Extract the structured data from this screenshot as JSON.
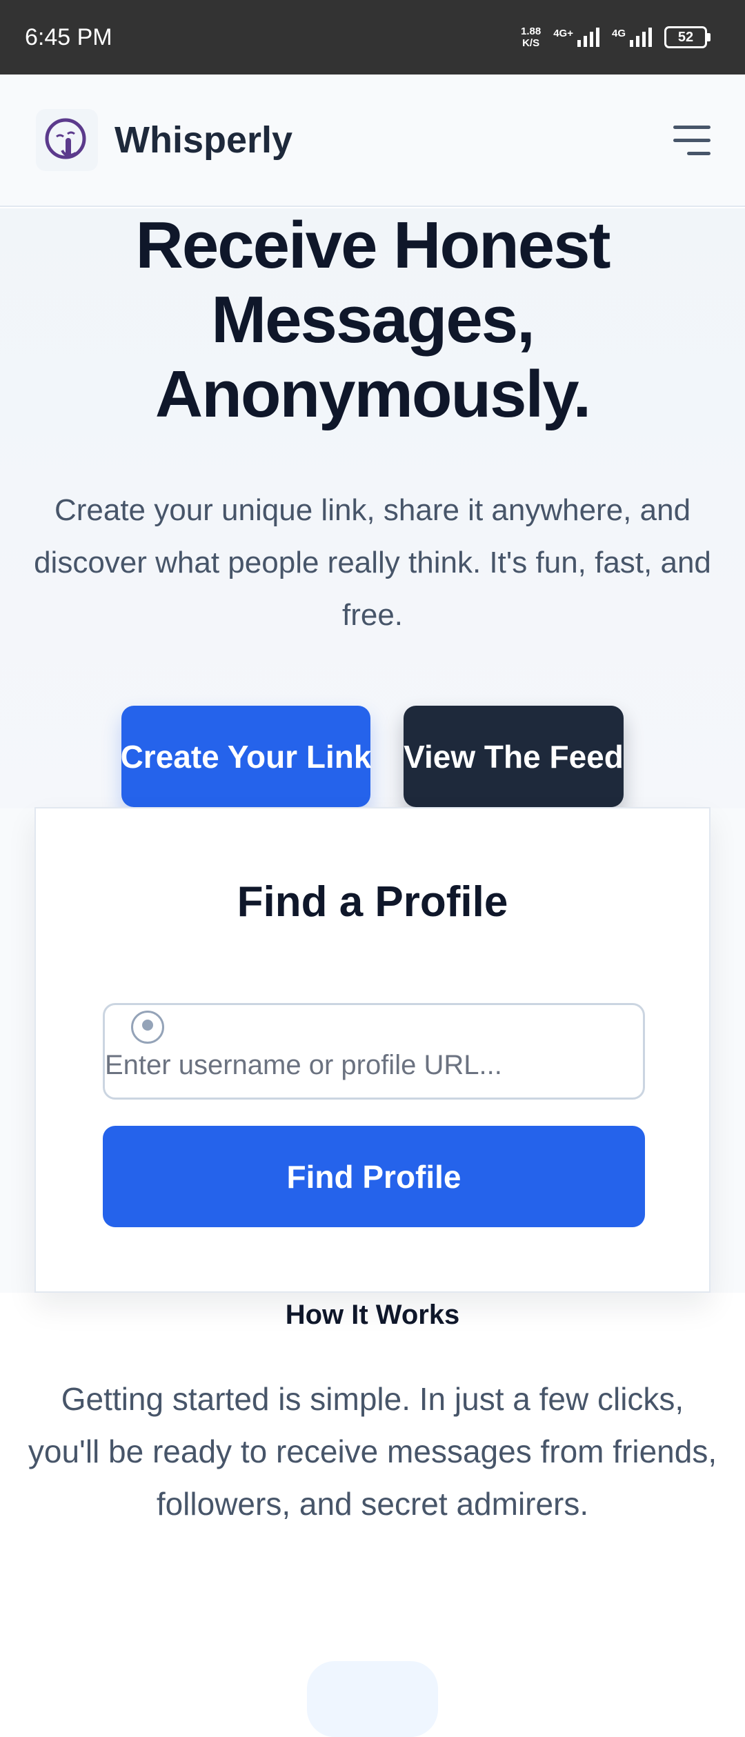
{
  "status_bar": {
    "time": "6:45 PM",
    "net_speed_value": "1.88",
    "net_speed_unit": "K/S",
    "signal_1_label": "4G+",
    "signal_2_label": "4G",
    "battery": "52"
  },
  "header": {
    "brand": "Whisperly",
    "logo_icon": "shush-face-icon",
    "menu_icon": "hamburger-menu-icon"
  },
  "hero": {
    "title_line1": "Receive Honest",
    "title_line2": "Messages,",
    "title_line3": "Anonymously.",
    "subtitle": "Create your unique link, share it anywhere, and discover what people really think. It's fun, fast, and free.",
    "create_button": "Create Your Link",
    "feed_button": "View The Feed"
  },
  "find_profile": {
    "title": "Find a Profile",
    "input_placeholder": "Enter username or profile URL...",
    "input_value": "",
    "button": "Find Profile"
  },
  "how_it_works": {
    "title": "How It Works",
    "description": "Getting started is simple. In just a few clicks, you'll be ready to receive messages from friends, followers, and secret admirers."
  },
  "colors": {
    "primary": "#2563eb",
    "dark": "#1e293b",
    "heading": "#0f172a",
    "muted": "#475569",
    "logo_purple": "#5b3a8c"
  }
}
